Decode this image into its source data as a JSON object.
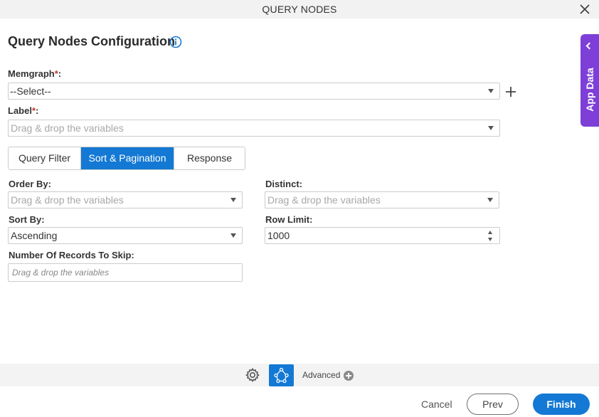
{
  "window": {
    "title": "QUERY NODES"
  },
  "page": {
    "heading": "Query Nodes Configuration"
  },
  "form": {
    "memgraph": {
      "label": "Memgraph",
      "required": "*",
      "colon": ":",
      "value": "--Select--"
    },
    "label_field": {
      "label": "Label",
      "required": "*",
      "colon": ":",
      "placeholder": "Drag & drop the variables"
    }
  },
  "tabs": [
    {
      "label": "Query Filter",
      "active": false
    },
    {
      "label": "Sort & Pagination",
      "active": true
    },
    {
      "label": "Response",
      "active": false
    }
  ],
  "sort": {
    "order_by": {
      "label": "Order By:",
      "placeholder": "Drag & drop the variables"
    },
    "distinct": {
      "label": "Distinct:",
      "placeholder": "Drag & drop the variables"
    },
    "sort_by": {
      "label": "Sort By:",
      "value": "Ascending"
    },
    "row_limit": {
      "label": "Row Limit:",
      "value": "1000"
    },
    "skip": {
      "label": "Number Of Records To Skip:",
      "placeholder": "Drag & drop the variables"
    }
  },
  "side_panel": {
    "label": "App Data"
  },
  "footer": {
    "advanced_label": "Advanced",
    "cancel_label": "Cancel",
    "prev_label": "Prev",
    "finish_label": "Finish"
  },
  "colors": {
    "accent": "#1479d4",
    "app_data": "#7e3fd8",
    "required": "#c0392b"
  },
  "icons": [
    "close-icon",
    "info-icon",
    "plus-icon",
    "chevron-left-icon",
    "gear-icon",
    "flow-icon",
    "add-circle-icon"
  ]
}
